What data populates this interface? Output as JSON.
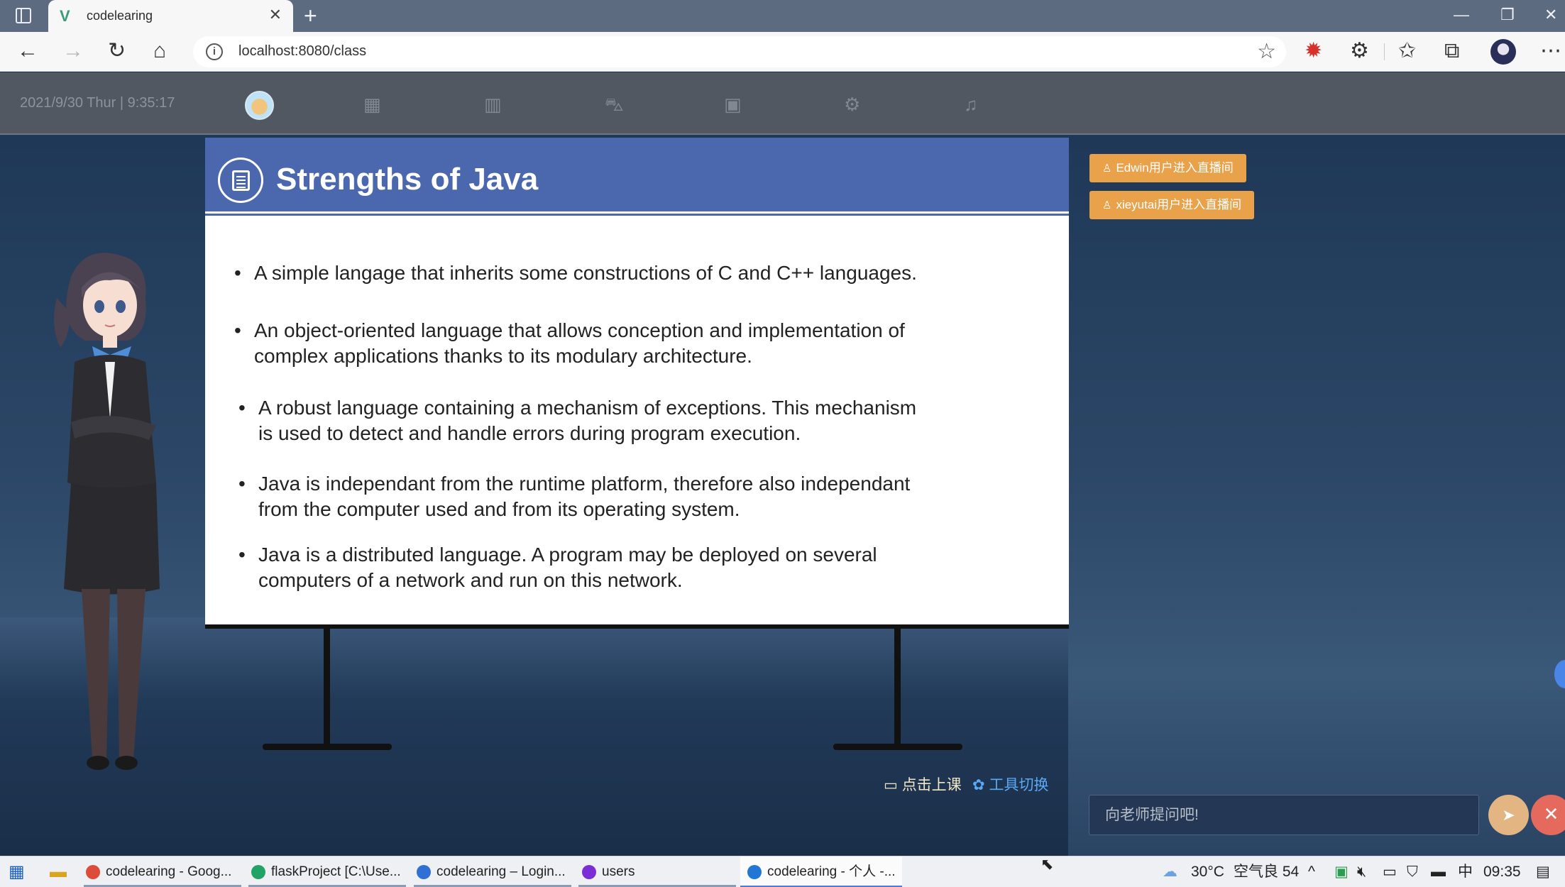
{
  "browser": {
    "tab_title": "codelearing",
    "url": "localhost:8080/class"
  },
  "header": {
    "datetime": "2021/9/30 Thur  |  9:35:17"
  },
  "slide": {
    "title": "Strengths of Java",
    "bullets": [
      {
        "lines": [
          "A simple langage that inherits some constructions of C and C++ languages."
        ]
      },
      {
        "lines": [
          "An object-oriented language that allows conception and implementation of",
          "complex applications thanks to its modulary architecture."
        ]
      },
      {
        "lines": [
          "A robust language containing a mechanism of exceptions. This mechanism",
          "is used to detect and handle errors during program execution."
        ]
      },
      {
        "lines": [
          "Java is independant from the runtime platform, therefore also independant",
          "from the computer used and from its operating system."
        ]
      },
      {
        "lines": [
          "Java is a distributed language. A program may be deployed on several",
          "computers of a network and run on this network."
        ]
      }
    ]
  },
  "notifications": [
    "Edwin用户进入直播间",
    "xieyutai用户进入直播间"
  ],
  "controls": {
    "start_class": "点击上课",
    "switch_tool": "工具切换"
  },
  "chat": {
    "placeholder": "向老师提问吧!"
  },
  "taskbar": {
    "items": [
      {
        "label": "codelearing - Goog...",
        "color": "#dd4b39"
      },
      {
        "label": "flaskProject [C:\\Use...",
        "color": "#21a366"
      },
      {
        "label": "codelearing – Login...",
        "color": "#2f6fd6"
      },
      {
        "label": "users",
        "color": "#7a2fd6"
      },
      {
        "label": "codelearing - 个人 -...",
        "color": "#2277d6"
      }
    ],
    "weather": "30°C",
    "air_quality": "空气良 54",
    "ime": "中",
    "clock": "09:35"
  }
}
